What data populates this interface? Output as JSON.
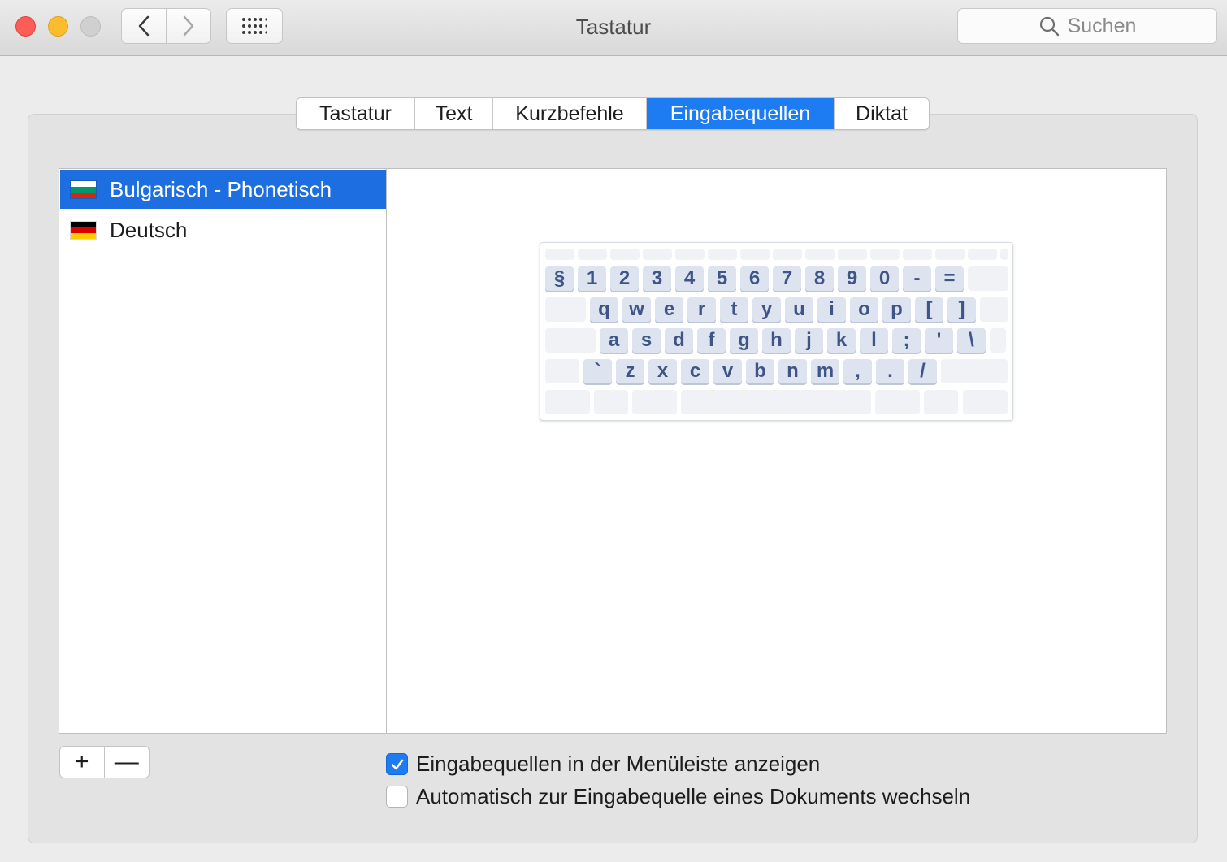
{
  "window": {
    "title": "Tastatur"
  },
  "toolbar": {
    "search_placeholder": "Suchen"
  },
  "tabs": [
    {
      "label": "Tastatur",
      "active": false
    },
    {
      "label": "Text",
      "active": false
    },
    {
      "label": "Kurzbefehle",
      "active": false
    },
    {
      "label": "Eingabequellen",
      "active": true
    },
    {
      "label": "Diktat",
      "active": false
    }
  ],
  "input_sources": [
    {
      "label": "Bulgarisch - Phonetisch",
      "selected": true,
      "flag": [
        "#ffffff",
        "#00966e",
        "#d62612"
      ]
    },
    {
      "label": "Deutsch",
      "selected": false,
      "flag": [
        "#000000",
        "#dd0000",
        "#ffce00"
      ]
    }
  ],
  "keyboard": {
    "rows": [
      [
        "",
        "",
        "",
        "",
        "",
        "",
        "",
        "",
        "",
        "",
        "",
        "",
        "",
        "",
        ""
      ],
      [
        "§",
        "1",
        "2",
        "3",
        "4",
        "5",
        "6",
        "7",
        "8",
        "9",
        "0",
        "-",
        "=",
        ""
      ],
      [
        "",
        "q",
        "w",
        "e",
        "r",
        "t",
        "y",
        "u",
        "i",
        "o",
        "p",
        "[",
        "]",
        ""
      ],
      [
        "",
        "a",
        "s",
        "d",
        "f",
        "g",
        "h",
        "j",
        "k",
        "l",
        ";",
        "'",
        "\\",
        ""
      ],
      [
        "",
        "`",
        "z",
        "x",
        "c",
        "v",
        "b",
        "n",
        "m",
        ",",
        ".",
        "/",
        ""
      ],
      [
        "",
        "",
        "",
        "",
        "",
        "",
        ""
      ]
    ]
  },
  "list_controls": {
    "add_label": "+",
    "remove_label": "—"
  },
  "options": [
    {
      "label": "Eingabequellen in der Menüleiste anzeigen",
      "checked": true
    },
    {
      "label": "Automatisch zur Eingabequelle eines Dokuments wechseln",
      "checked": false
    }
  ],
  "colors": {
    "accent": "#1d7cf2",
    "selection": "#1d6ee0",
    "key_text": "#3f5587"
  }
}
